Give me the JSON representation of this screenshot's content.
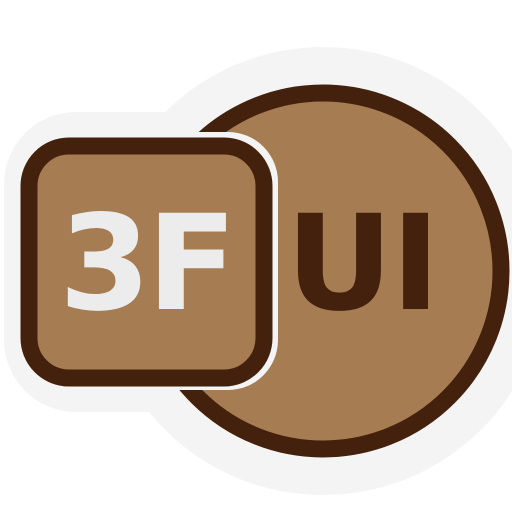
{
  "logo": {
    "left_text": "3F",
    "right_text": "UI",
    "colors": {
      "fill": "#a67c52",
      "outline": "#43210c",
      "halo": "#f4f4f4",
      "left_text": "#ececec",
      "right_text": "#43210c"
    },
    "shapes": {
      "back": "circle",
      "front": "rounded-square"
    }
  }
}
